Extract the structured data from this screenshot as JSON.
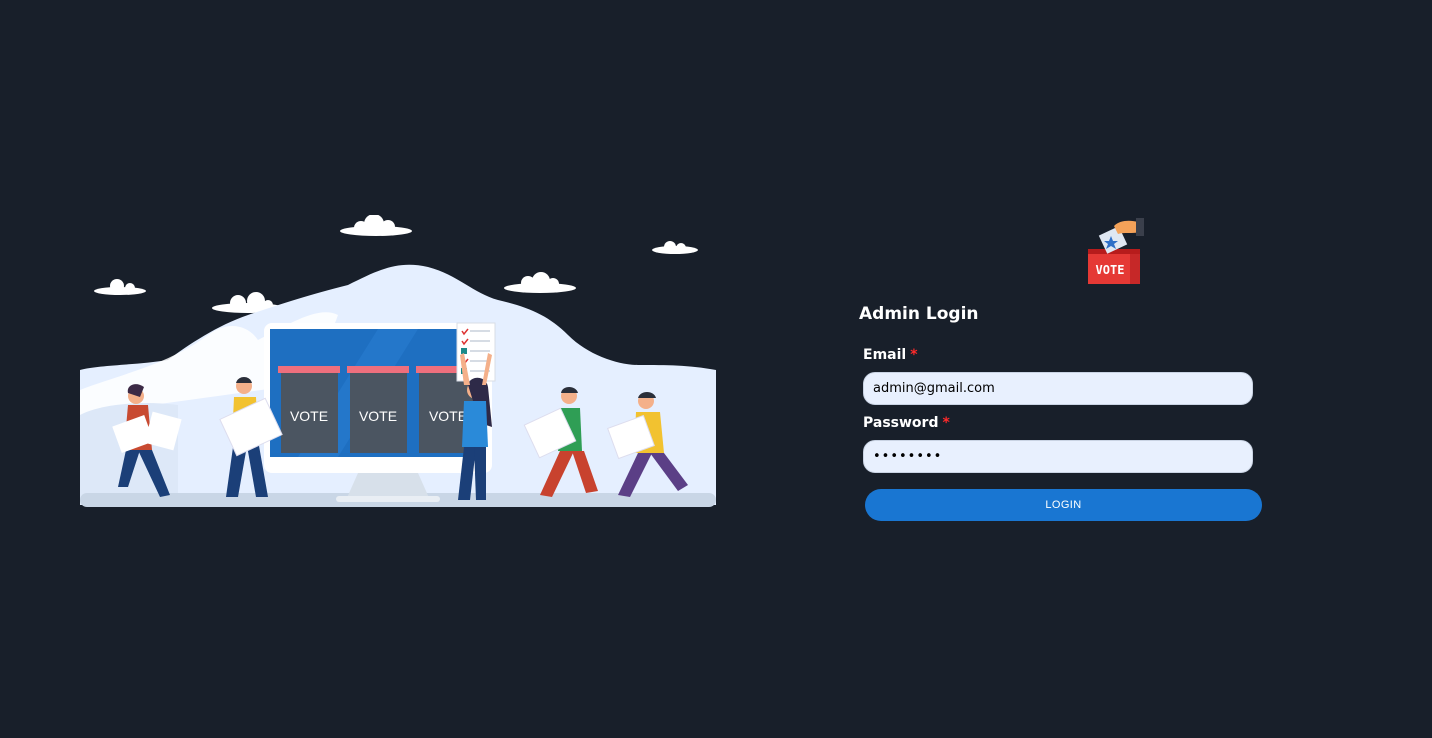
{
  "illustration": {
    "booth_labels": [
      "VOTE",
      "VOTE",
      "VOTE"
    ]
  },
  "logo": {
    "text": "VOTE"
  },
  "form": {
    "title": "Admin Login",
    "email": {
      "label": "Email",
      "required_mark": "*",
      "value": "admin@gmail.com"
    },
    "password": {
      "label": "Password",
      "required_mark": "*",
      "value": "••••••••"
    },
    "login_label": "LOGIN"
  },
  "colors": {
    "background": "#181f2a",
    "accent": "#1976d2",
    "input_bg": "#e8f0fe",
    "required": "#ff2a2a"
  }
}
